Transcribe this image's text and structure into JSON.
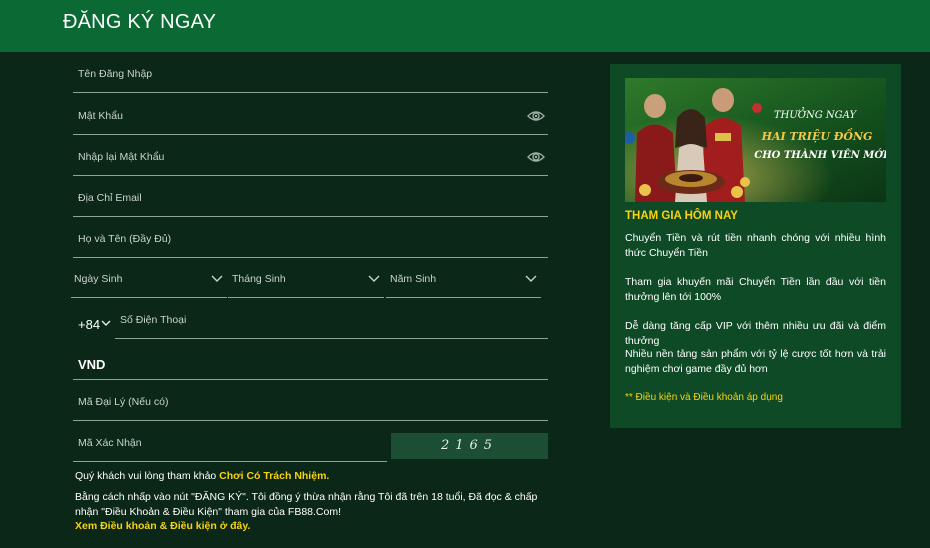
{
  "header": {
    "title": "ĐĂNG KÝ NGAY"
  },
  "form": {
    "username_placeholder": "Tên Đăng Nhập",
    "password_placeholder": "Mật Khẩu",
    "confirm_password_placeholder": "Nhập lại Mật Khẩu",
    "email_placeholder": "Địa Chỉ Email",
    "fullname_placeholder": "Họ và Tên (Đầy Đủ)",
    "birth_day_placeholder": "Ngày Sinh",
    "birth_month_placeholder": "Tháng Sinh",
    "birth_year_placeholder": "Năm Sinh",
    "phone_prefix": "+84",
    "phone_placeholder": "Số Điện Thoại",
    "currency": "VND",
    "agent_code_placeholder": "Mã Đại Lý (Nếu có)",
    "captcha_placeholder": "Mã Xác Nhận",
    "captcha_code": "2165"
  },
  "notice": {
    "responsible_prefix": "Quý khách vui lòng tham khảo ",
    "responsible_link": "Chơi Có Trách Nhiệm.",
    "terms_text": "Bằng cách nhấp vào nút \"ĐĂNG KÝ\". Tôi đồng ý thừa nhận rằng Tôi đã trên 18 tuổi, Đã đọc & chấp nhận \"Điều Khoản & Điều Kiện\" tham gia của FB88.Com!",
    "terms_link": "Xem Điều khoản & Điều kiện ở đây."
  },
  "promo": {
    "banner_line1": "THƯỞNG NGAY",
    "banner_line2": "HAI TRIỆU ĐỒNG",
    "banner_line3": "CHO THÀNH VIÊN MỚI",
    "heading": "THAM GIA HÔM NAY",
    "items": [
      "Chuyển Tiền và rút tiền nhanh chóng với nhiều hình thức Chuyển Tiền",
      "Tham gia khuyến mãi Chuyển Tiền lần đầu với tiền thưởng lên tới 100%",
      "Dễ dàng tăng cấp VIP với thêm nhiều ưu đãi và điểm thưởng",
      "Nhiều nền tảng sản phẩm với tỷ lệ cược tốt hơn và trải nghiệm chơi game đầy đủ hơn"
    ],
    "note": "** Điều kiện và Điều khoản áp dụng"
  },
  "colors": {
    "header_bg": "#0b6a33",
    "page_bg": "#0b2717",
    "accent_yellow": "#f7d312",
    "panel_bg": "#0f4a27"
  }
}
